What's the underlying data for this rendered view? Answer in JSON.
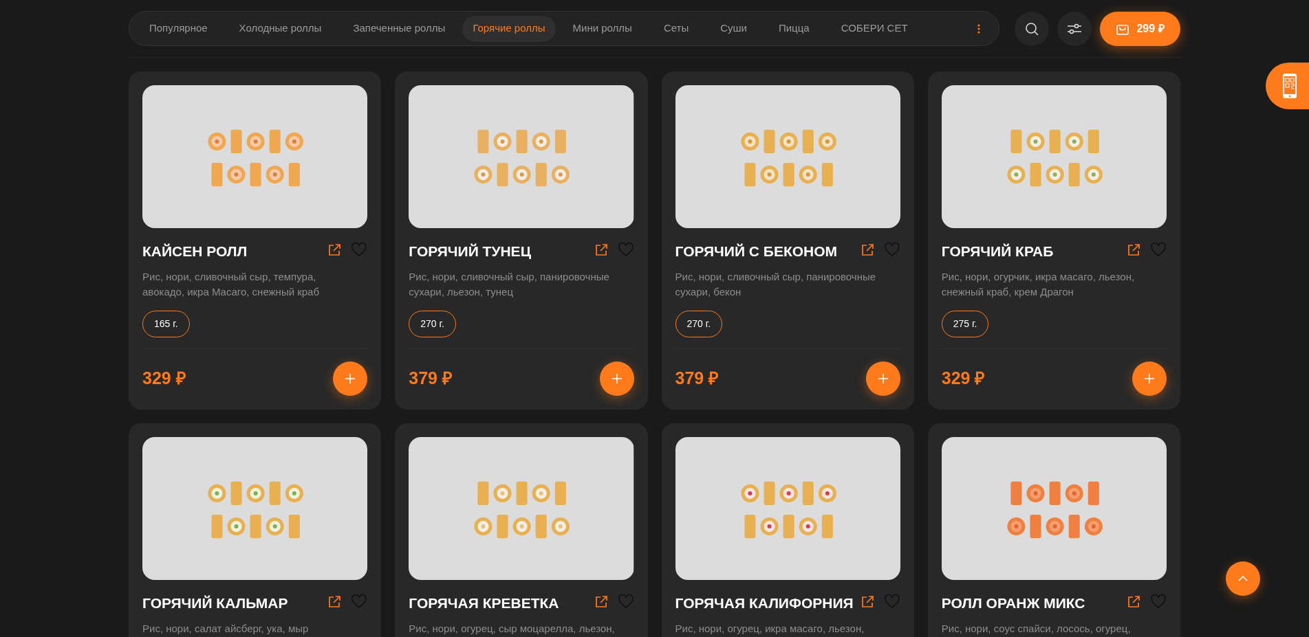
{
  "nav": {
    "tabs": [
      {
        "label": "Популярное",
        "selected": false
      },
      {
        "label": "Холодные роллы",
        "selected": false
      },
      {
        "label": "Запеченные роллы",
        "selected": false
      },
      {
        "label": "Горячие роллы",
        "selected": true
      },
      {
        "label": "Мини роллы",
        "selected": false
      },
      {
        "label": "Сеты",
        "selected": false
      },
      {
        "label": "Суши",
        "selected": false
      },
      {
        "label": "Пицца",
        "selected": false
      },
      {
        "label": "СОБЕРИ СЕТ",
        "selected": false
      }
    ],
    "cart_total": "299 ₽"
  },
  "products": [
    {
      "title": "КАЙСЕН РОЛЛ",
      "description": "Рис, нори, сливочный сыр, темпура, авокадо, икра Масаго, снежный краб",
      "weight": "165 г.",
      "price": "329 ₽"
    },
    {
      "title": "ГОРЯЧИЙ ТУНЕЦ",
      "description": "Рис, нори, сливочный сыр, панировочные сухари, льезон, тунец",
      "weight": "270 г.",
      "price": "379 ₽"
    },
    {
      "title": "ГОРЯЧИЙ С БЕКОНОМ",
      "description": "Рис, нори, сливочный сыр, панировочные сухари, бекон",
      "weight": "270 г.",
      "price": "379 ₽"
    },
    {
      "title": "ГОРЯЧИЙ КРАБ",
      "description": "Рис, нори, огурчик, икра масаго, льезон, снежный краб, крем Драгон",
      "weight": "275 г.",
      "price": "329 ₽"
    },
    {
      "title": "ГОРЯЧИЙ КАЛЬМАР",
      "description": "Рис, нори, салат айсберг, ука, мыр"
    },
    {
      "title": "ГОРЯЧАЯ КРЕВЕТКА",
      "description": "Рис, нори, огурец, сыр моцарелла, льезон,"
    },
    {
      "title": "ГОРЯЧАЯ КАЛИФОРНИЯ",
      "description": "Рис, нори, огурец, икра масаго, льезон,"
    },
    {
      "title": "РОЛЛ ОРАНЖ МИКС",
      "description": "Рис, нори, соус спайси, лосось, огурец,"
    }
  ]
}
